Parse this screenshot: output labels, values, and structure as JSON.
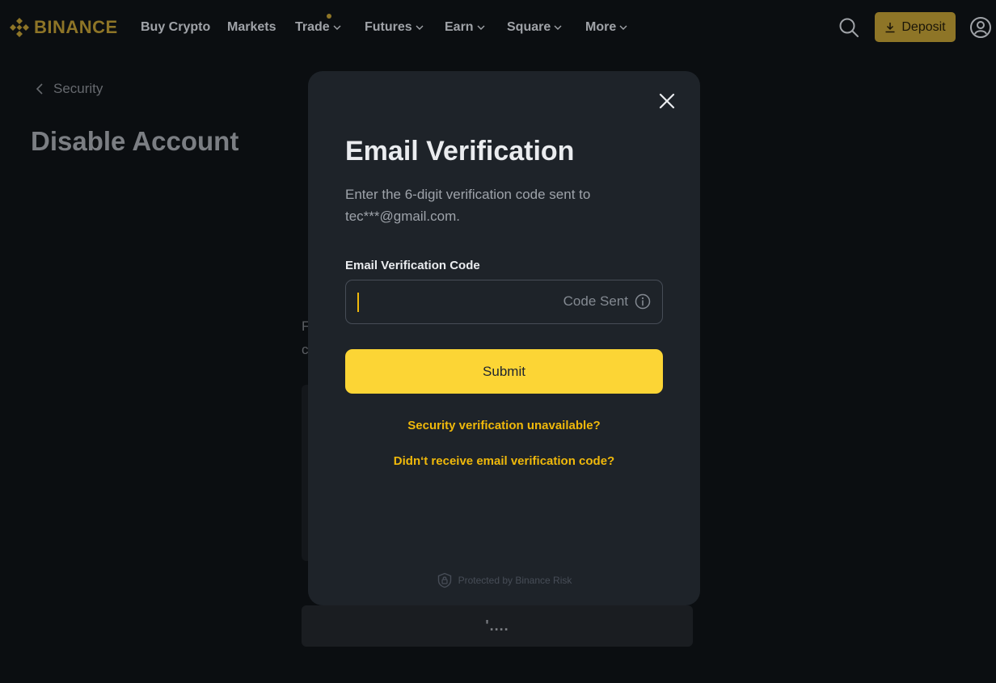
{
  "header": {
    "logo_text": "BINANCE",
    "nav": [
      {
        "label": "Buy Crypto"
      },
      {
        "label": "Markets"
      },
      {
        "label": "Trade"
      },
      {
        "label": "Futures"
      },
      {
        "label": "Earn"
      },
      {
        "label": "Square"
      },
      {
        "label": "More"
      }
    ],
    "deposit_label": "Deposit",
    "icons": {
      "logo": "binance-logo-icon",
      "search": "search-icon",
      "deposit": "download-icon",
      "profile": "user-icon",
      "dropdown": "chevron-down-icon"
    }
  },
  "background": {
    "breadcrumb_label": "Security",
    "page_title": "Disable Account",
    "partial_text_1": "F",
    "partial_text_2": "c",
    "bottom_button_label": "'...."
  },
  "modal": {
    "title": "Email Verification",
    "description_line1": "Enter the 6-digit verification code sent to",
    "description_line2": "tec***@gmail.com.",
    "field_label": "Email Verification Code",
    "code_value": "",
    "code_status": "Code Sent",
    "submit_label": "Submit",
    "link_security_unavailable": "Security verification unavailable?",
    "link_no_code": "Didn‘t receive email verification code?",
    "protected_text": "Protected by Binance Risk"
  },
  "colors": {
    "background": "#0b0e11",
    "modal": "#1e2329",
    "accent_yellow": "#fcd535",
    "link_yellow": "#f0b90b",
    "muted_gold": "#8e7527"
  }
}
